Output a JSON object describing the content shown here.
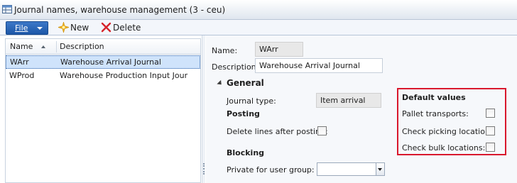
{
  "window": {
    "title": "Journal names, warehouse management (3 - ceu)",
    "app_icon": "table-form-icon"
  },
  "toolbar": {
    "file_label": "File",
    "new_label": "New",
    "new_icon": "sparkle-new-icon",
    "delete_label": "Delete",
    "delete_icon": "red-x-delete-icon"
  },
  "grid": {
    "columns": [
      "Name",
      "Description"
    ],
    "sort_column": "Name",
    "sort_direction": "ascending",
    "rows": [
      {
        "name": "WArr",
        "description": "Warehouse Arrival Journal",
        "selected": true
      },
      {
        "name": "WProd",
        "description": "Warehouse Production Input Jour",
        "selected": false
      }
    ]
  },
  "detail": {
    "name_label": "Name:",
    "name_value": "WArr",
    "description_label": "Description:",
    "description_value": "Warehouse Arrival Journal",
    "general_title": "General",
    "journal_type_label": "Journal type:",
    "journal_type_value": "Item arrival",
    "posting_title": "Posting",
    "delete_lines_label": "Delete lines after posting:",
    "delete_lines_checked": false,
    "blocking_title": "Blocking",
    "private_group_label": "Private for user group:",
    "private_group_value": "",
    "default_values_title": "Default values",
    "pallet_transports_label": "Pallet transports:",
    "pallet_transports_checked": false,
    "check_picking_label": "Check picking location:",
    "check_picking_checked": false,
    "check_bulk_label": "Check bulk locations:",
    "check_bulk_checked": false
  },
  "colors": {
    "accent_blue": "#1d57a8",
    "selection": "#cfe3fb",
    "highlight_box": "#d9182d"
  }
}
